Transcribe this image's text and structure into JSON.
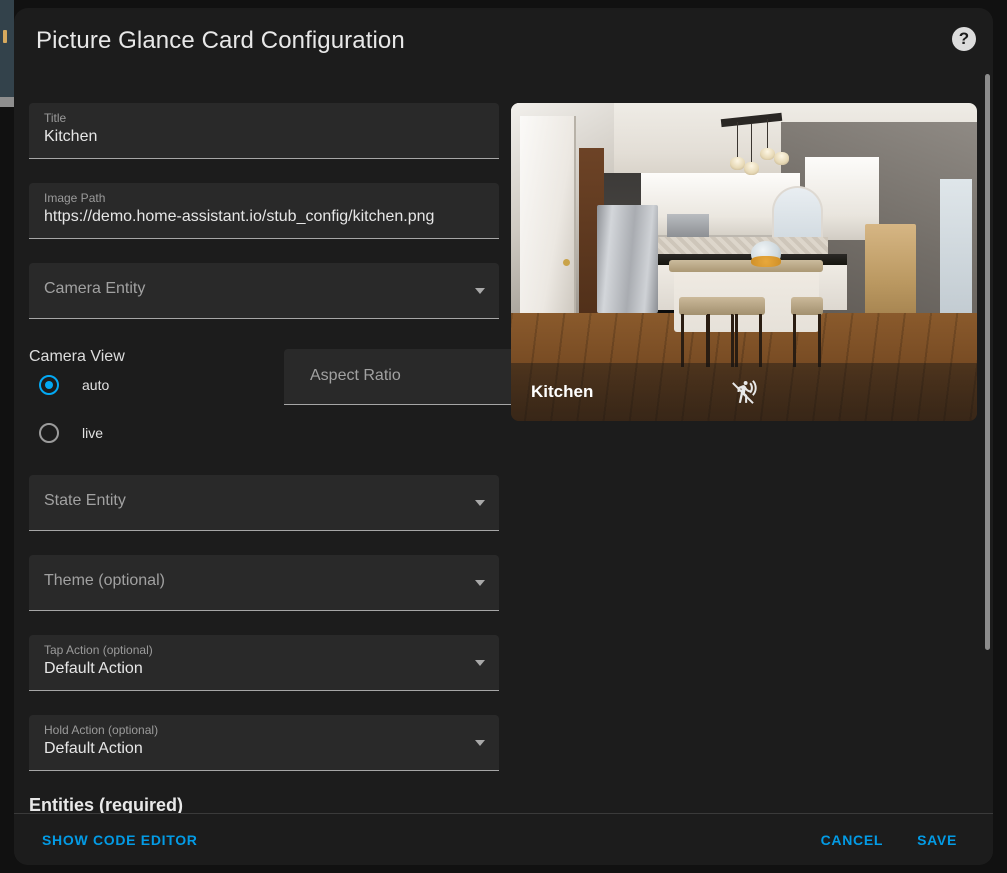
{
  "dialog": {
    "title": "Picture Glance Card Configuration",
    "help_icon": "help-circle-icon"
  },
  "form": {
    "title_field": {
      "label": "Title",
      "value": "Kitchen"
    },
    "image_path_field": {
      "label": "Image Path",
      "value": "https://demo.home-assistant.io/stub_config/kitchen.png"
    },
    "camera_entity_field": {
      "placeholder": "Camera Entity",
      "value": ""
    },
    "camera_view": {
      "legend": "Camera View",
      "options": [
        {
          "label": "auto",
          "selected": true
        },
        {
          "label": "live",
          "selected": false
        }
      ]
    },
    "aspect_ratio_field": {
      "placeholder": "Aspect Ratio",
      "value": ""
    },
    "state_entity_field": {
      "placeholder": "State Entity",
      "value": ""
    },
    "theme_field": {
      "placeholder": "Theme (optional)",
      "value": ""
    },
    "tap_action_field": {
      "label": "Tap Action (optional)",
      "value": "Default Action"
    },
    "hold_action_field": {
      "label": "Hold Action (optional)",
      "value": "Default Action"
    },
    "entities_heading": "Entities (required)"
  },
  "preview": {
    "title": "Kitchen",
    "icon": "motion-sensor-off-icon"
  },
  "footer": {
    "show_code_editor": "SHOW CODE EDITOR",
    "cancel": "CANCEL",
    "save": "SAVE"
  },
  "colors": {
    "accent": "#03a9f4",
    "link": "#039be5",
    "dialog_bg": "#1c1c1c",
    "field_bg": "#292929",
    "page_bg": "#111111"
  }
}
